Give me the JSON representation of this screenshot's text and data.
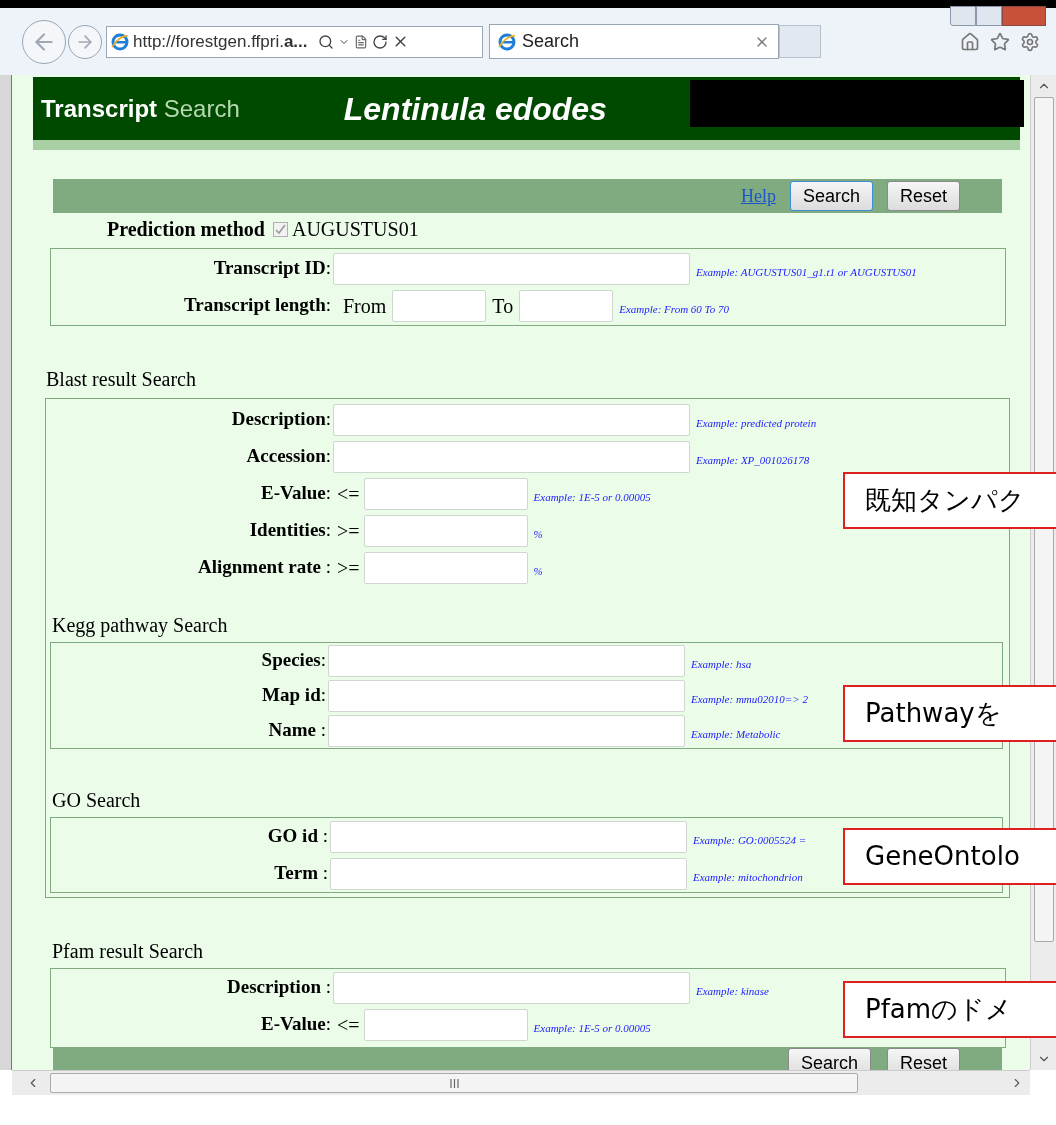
{
  "browser": {
    "url": "http://forestgen.ffpri.**a...**",
    "tab": {
      "title": "Search",
      "selected": true
    }
  },
  "header": {
    "title_bold": "Transcript",
    "title_light": "Search",
    "species": "Lentinula edodes"
  },
  "toolbar_top": {
    "help": "Help",
    "buttons": [
      "Search",
      "Reset"
    ]
  },
  "prediction": {
    "label": "Prediction method",
    "checked": true,
    "disabled": true,
    "value": "AUGUSTUS01"
  },
  "transcript": {
    "rows": [
      {
        "kind": "text",
        "label": "**Transcript ID**:",
        "example": "Example: AUGUSTUS01_g1.t1 or AUGUSTUS01"
      },
      {
        "kind": "range",
        "label": "**Transcript length**:",
        "from_label": "From",
        "to_label": "To",
        "example": "Example: From 60 To 70"
      }
    ]
  },
  "blast": {
    "title": "Blast result Search",
    "rows": [
      {
        "kind": "text",
        "label": "**Description**:",
        "example": "Example: predicted protein"
      },
      {
        "kind": "text",
        "label": "**Accession**:",
        "example": "Example: XP_001026178"
      },
      {
        "kind": "compare",
        "label": "**E-Value**:",
        "op": "<=",
        "example": "Example: 1E-5 or 0.00005"
      },
      {
        "kind": "compare",
        "label": "**Identities**:",
        "op": ">=",
        "example": "%"
      },
      {
        "kind": "compare",
        "label": "**Alignment rate** :",
        "op": ">=",
        "example": "%"
      }
    ],
    "subsections": [
      {
        "title": "Kegg pathway Search",
        "rows": [
          {
            "kind": "text",
            "label": "**Species**:",
            "example": "Example: hsa"
          },
          {
            "kind": "text",
            "label": "**Map id**:",
            "example": "Example: mmu02010=> 2"
          },
          {
            "kind": "text",
            "label": "**Name** :",
            "example": "Example: Metabolic"
          }
        ]
      },
      {
        "title": "GO Search",
        "rows": [
          {
            "kind": "text",
            "label": "**GO id** :",
            "example": "Example: GO:0005524 ="
          },
          {
            "kind": "text",
            "label": "**Term** :",
            "example": "Example: mitochondrion"
          }
        ]
      }
    ]
  },
  "pfam": {
    "title": "Pfam result Search",
    "rows": [
      {
        "kind": "text",
        "label": "**Description** :",
        "example": "Example: kinase"
      },
      {
        "kind": "compare",
        "label": "**E-Value**:",
        "op": "<=",
        "example": "Example: 1E-5 or 0.00005"
      }
    ]
  },
  "toolbar_bottom": {
    "buttons": [
      "Search",
      "Reset"
    ]
  },
  "callouts": [
    "既知タンパク",
    "Pathwayを",
    "GeneOntolo",
    "Pfamのドメ"
  ]
}
